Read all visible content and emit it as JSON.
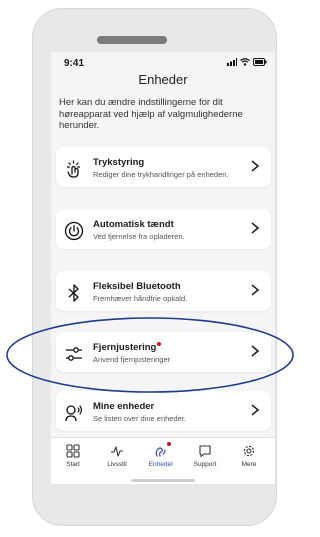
{
  "status_bar": {
    "time": "9:41"
  },
  "header": {
    "title": "Enheder"
  },
  "intro_text": "Her kan du ændre indstillingerne for dit høreapparat ved hjælp af valgmulighederne herunder.",
  "menu": [
    {
      "title": "Trykstyring",
      "subtitle": "Rediger dine trykhandlinger på enheden.",
      "icon": "tap-gesture-icon",
      "badge": false
    },
    {
      "title": "Automatisk tændt",
      "subtitle": "Ved fjernelse fra opladeren.",
      "icon": "power-icon",
      "badge": false
    },
    {
      "title": "Fleksibel Bluetooth",
      "subtitle": "Fremhæver håndfrie opkald.",
      "icon": "bluetooth-icon",
      "badge": false
    },
    {
      "title": "Fjernjustering",
      "subtitle": "Anvend fjernjusteringer",
      "icon": "sliders-icon",
      "badge": true
    },
    {
      "title": "Mine enheder",
      "subtitle": "Se listen over dine enheder.",
      "icon": "hearing-aid-icon",
      "badge": false
    }
  ],
  "tabs": [
    {
      "label": "Start",
      "icon": "grid-icon",
      "active": false,
      "badge": false
    },
    {
      "label": "Livsstil",
      "icon": "activity-icon",
      "active": false,
      "badge": false
    },
    {
      "label": "Enheder",
      "icon": "hearing-aid-icon",
      "active": true,
      "badge": true
    },
    {
      "label": "Support",
      "icon": "chat-icon",
      "active": false,
      "badge": false
    },
    {
      "label": "Mere",
      "icon": "gear-icon",
      "active": false,
      "badge": false
    }
  ],
  "colors": {
    "accent": "#2f49a8",
    "badge": "#c8102e",
    "annotation": "#1f3a8f"
  }
}
